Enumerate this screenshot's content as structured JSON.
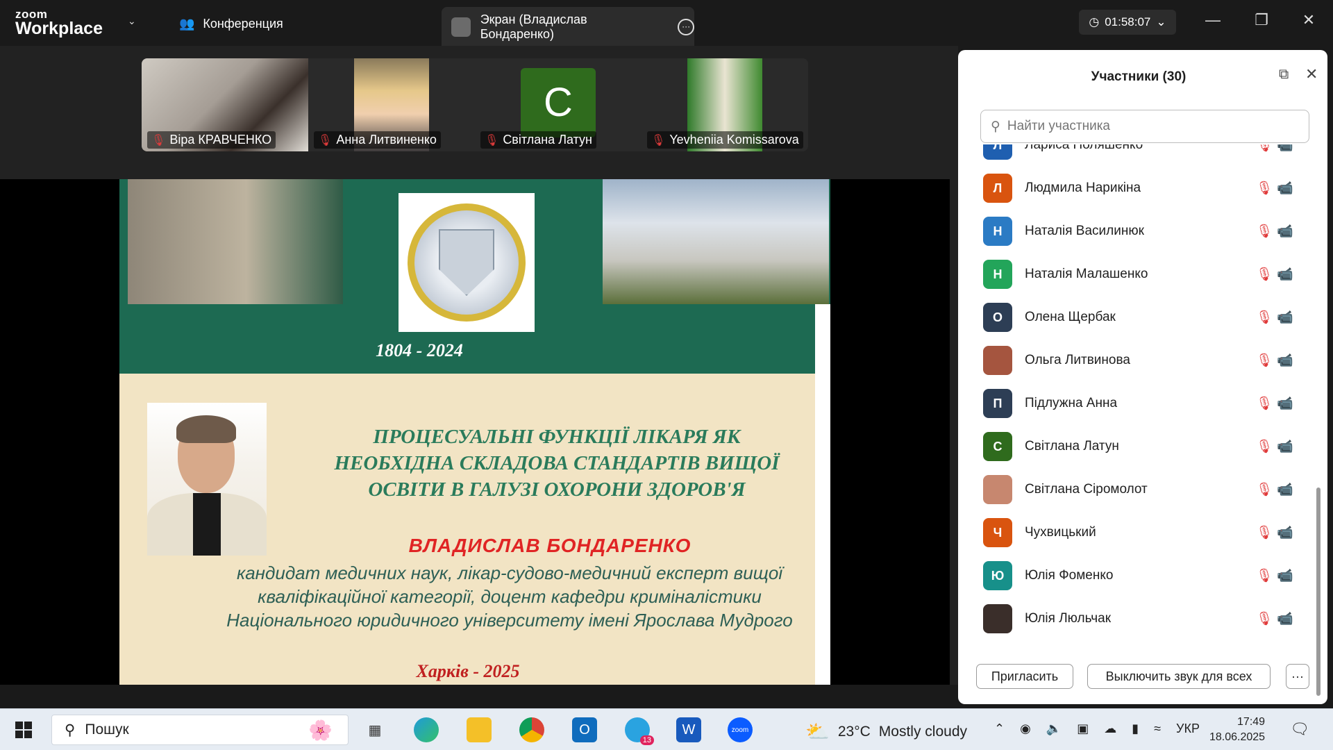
{
  "app": {
    "logo_small": "zoom",
    "logo_big": "Workplace",
    "conference_label": "Конференция",
    "screen_tab_label": "Экран (Владислав Бондаренко)",
    "timer": "01:58:07"
  },
  "thumbnails": [
    {
      "name": "Віра КРАВЧЕНКО"
    },
    {
      "name": "Анна Литвиненко"
    },
    {
      "name": "Світлана Латун",
      "initial": "С"
    },
    {
      "name": "Yevheniia Komissarova"
    }
  ],
  "slide": {
    "years": "1804 - 2024",
    "title_lines": [
      "ПРОЦЕСУАЛЬНІ ФУНКЦІЇ ЛІКАРЯ ЯК",
      "НЕОБХІДНА СКЛАДОВА  СТАНДАРТІВ ВИЩОЇ",
      "ОСВІТИ В ГАЛУЗІ ОХОРОНИ ЗДОРОВ'Я"
    ],
    "author": "ВЛАДИСЛАВ  БОНДАРЕНКО",
    "desc_lines": [
      "кандидат медичних наук, лікар-судово-медичний експерт вищої",
      "кваліфікаційної категорії, доцент кафедри криміналістики",
      "Національного юридичного університету імені Ярослава Мудрого"
    ],
    "city": "Харків -  2025"
  },
  "panel": {
    "title": "Участники (30)",
    "search_placeholder": "Найти участника",
    "participants": [
      {
        "name": "Лариса Поляшенко",
        "initial": "Л",
        "color": "#1f5fb0",
        "cam": "off"
      },
      {
        "name": "Людмила Нарикіна",
        "initial": "Л",
        "color": "#d9540f",
        "cam": "off"
      },
      {
        "name": "Наталія Василинюк",
        "initial": "Н",
        "color": "#2b7bc4",
        "cam": "off"
      },
      {
        "name": "Наталія Малашенко",
        "initial": "Н",
        "color": "#23a55a",
        "cam": "off"
      },
      {
        "name": "Олена Щербак",
        "initial": "О",
        "color": "#2d3e55",
        "cam": "off"
      },
      {
        "name": "Ольга Литвинова",
        "initial": "",
        "color": "#a5553f",
        "cam": "on"
      },
      {
        "name": "Підлужна Анна",
        "initial": "П",
        "color": "#2d3e55",
        "cam": "off"
      },
      {
        "name": "Світлана Латун",
        "initial": "С",
        "color": "#2f6b1d",
        "cam": "off"
      },
      {
        "name": "Світлана Сіромолот",
        "initial": "",
        "color": "#c7876f",
        "cam": "off"
      },
      {
        "name": "Чухвицький",
        "initial": "Ч",
        "color": "#d9540f",
        "cam": "off"
      },
      {
        "name": "Юлія Фоменко",
        "initial": "Ю",
        "color": "#17908a",
        "cam": "off"
      },
      {
        "name": "Юлія Люльчак",
        "initial": "",
        "color": "#3a2e2a",
        "cam": "off"
      }
    ],
    "invite_label": "Пригласить",
    "mute_all_label": "Выключить звук для всех",
    "more_label": "···"
  },
  "taskbar": {
    "search_label": "Пошук",
    "telegram_badge": "13",
    "zoom_label": "zoom",
    "temperature": "23°C",
    "weather_text": "Mostly cloudy",
    "lang": "УКР",
    "time": "17:49",
    "date": "18.06.2025"
  }
}
